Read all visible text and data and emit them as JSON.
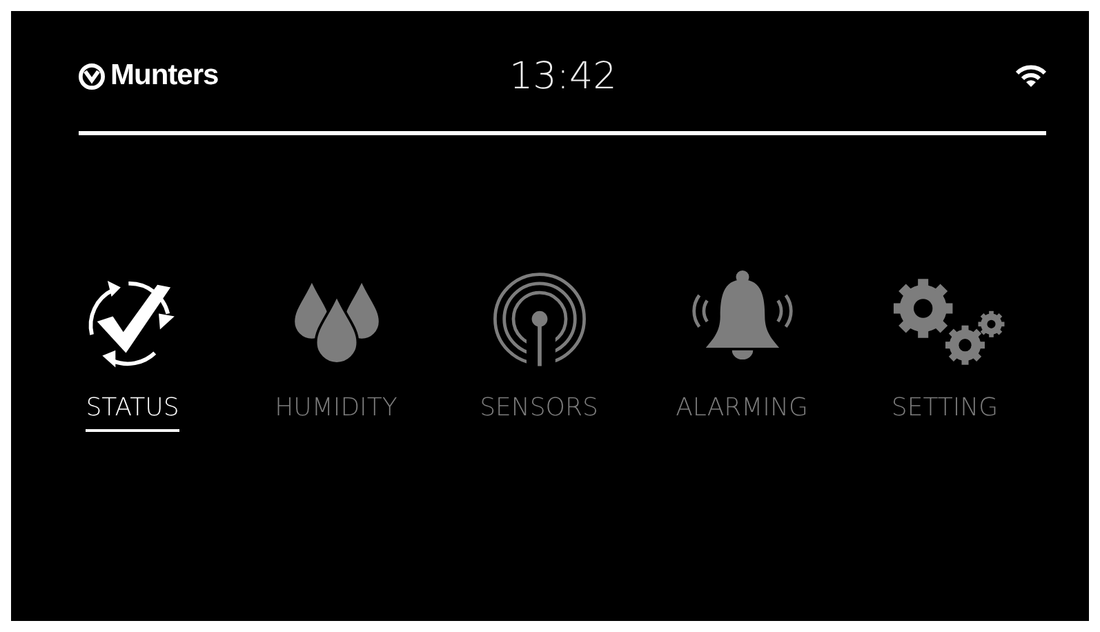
{
  "header": {
    "brand": "Munters",
    "time": "13:42"
  },
  "menu": [
    {
      "kind": "status",
      "label": "STATUS",
      "selected": true
    },
    {
      "kind": "humidity",
      "label": "HUMIDITY",
      "selected": false
    },
    {
      "kind": "sensors",
      "label": "SENSORS",
      "selected": false
    },
    {
      "kind": "alarming",
      "label": "ALARMING",
      "selected": false
    },
    {
      "kind": "setting",
      "label": "SETTING",
      "selected": false
    }
  ]
}
